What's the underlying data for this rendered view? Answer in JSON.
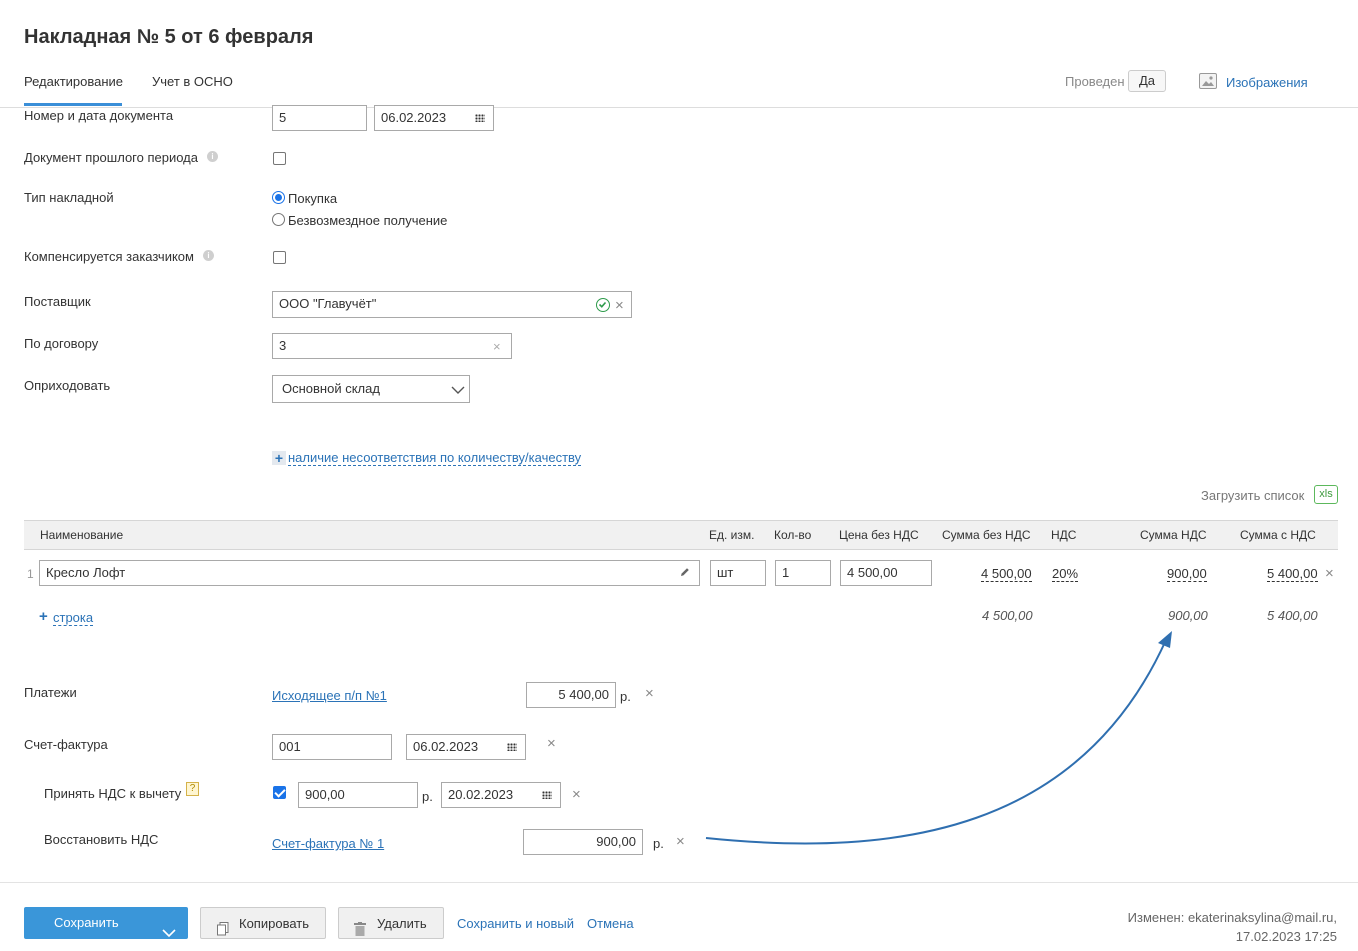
{
  "header": {
    "title": "Накладная № 5 от 6 февраля",
    "tabs": [
      "Редактирование",
      "Учет в ОСНО"
    ],
    "posted_label": "Проведен",
    "posted_value": "Да",
    "images_label": "Изображения"
  },
  "form": {
    "doc_number_label": "Номер и дата документа",
    "doc_number": "5",
    "doc_date": "06.02.2023",
    "past_period_label": "Документ прошлого периода",
    "type_label": "Тип накладной",
    "type_options": [
      "Покупка",
      "Безвозмездное получение"
    ],
    "type_selected": "Покупка",
    "compensated_label": "Компенсируется заказчиком",
    "supplier_label": "Поставщик",
    "supplier_value": "ООО \"Главучёт\"",
    "contract_label": "По договору",
    "contract_value": "3",
    "receive_label": "Оприходовать",
    "receive_value": "Основной склад",
    "mismatch_link": "наличие несоответствия по количеству/качеству",
    "upload_label": "Загрузить список",
    "xls_badge": "xls"
  },
  "table": {
    "columns": [
      "Наименование",
      "Ед. изм.",
      "Кол-во",
      "Цена без НДС",
      "Сумма без НДС",
      "НДС",
      "Сумма НДС",
      "Сумма с НДС"
    ],
    "rows": [
      {
        "index": "1",
        "name": "Кресло Лофт",
        "unit": "шт",
        "qty": "1",
        "price": "4 500,00",
        "sum_without_vat": "4 500,00",
        "vat_rate": "20%",
        "vat_sum": "900,00",
        "sum_with_vat": "5 400,00"
      }
    ],
    "add_row_link": "строка",
    "totals": {
      "sum_without_vat": "4 500,00",
      "vat_sum": "900,00",
      "sum_with_vat": "5 400,00"
    }
  },
  "payments": {
    "label": "Платежи",
    "link": "Исходящее п/п №1",
    "amount": "5 400,00",
    "currency": "р."
  },
  "invoice": {
    "label": "Счет-фактура",
    "number": "001",
    "date": "06.02.2023"
  },
  "vat_deduction": {
    "label": "Принять НДС к вычету",
    "help": "?",
    "amount": "900,00",
    "currency": "р.",
    "date": "20.02.2023"
  },
  "vat_restore": {
    "label": "Восстановить НДС",
    "link": "Счет-фактура № 1",
    "amount": "900,00",
    "currency": "р."
  },
  "footer": {
    "save": "Сохранить",
    "copy": "Копировать",
    "delete": "Удалить",
    "save_new": "Сохранить и новый",
    "cancel": "Отмена",
    "changed_by": "Изменен: ekaterinaksylina@mail.ru,",
    "changed_at": "17.02.2023 17:25"
  },
  "colors": {
    "accent": "#2b73b7",
    "primary_button": "#3a96d9",
    "arrow": "#2f6fb0",
    "check_green": "#2e9b4b"
  }
}
